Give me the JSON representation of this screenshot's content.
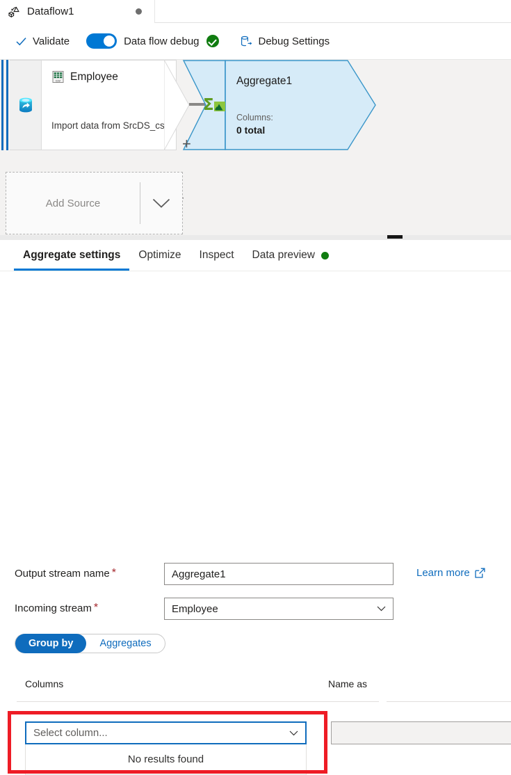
{
  "tab": {
    "icon": "dataflow-icon",
    "title": "Dataflow1",
    "dirty_dot": "unsaved-indicator"
  },
  "toolbar": {
    "validate_label": "Validate",
    "validate_icon": "checkmark-icon",
    "debug_toggle_label": "Data flow debug",
    "debug_toggle_state": "on",
    "debug_status_icon": "success-check-icon",
    "debug_settings_label": "Debug Settings",
    "debug_settings_icon": "database-export-icon"
  },
  "canvas": {
    "source_node": {
      "title": "Employee",
      "title_icon": "csv-file-icon",
      "side_icon": "azure-data-lake-icon",
      "subtitle": "Import data from SrcDS_csv",
      "add_icon": "plus-icon"
    },
    "aggregate_node": {
      "title": "Aggregate1",
      "icon": "sigma-aggregate-icon",
      "columns_label": "Columns:",
      "columns_total": "0 total",
      "add_icon": "plus-icon",
      "fill_color": "#d6ebf8",
      "border_color": "#3a96c9"
    },
    "add_source": {
      "label": "Add Source",
      "chevron_icon": "chevron-down-icon"
    }
  },
  "splitter": {
    "handle": "resize-handle"
  },
  "panel_tabs": [
    {
      "label": "Aggregate settings",
      "selected": true
    },
    {
      "label": "Optimize",
      "selected": false
    },
    {
      "label": "Inspect",
      "selected": false
    },
    {
      "label": "Data preview",
      "selected": false,
      "status_dot": "#107c10"
    }
  ],
  "settings": {
    "output_stream": {
      "label": "Output stream name",
      "required": "*",
      "value": "Aggregate1"
    },
    "incoming_stream": {
      "label": "Incoming stream",
      "required": "*",
      "value": "Employee",
      "chevron_icon": "chevron-down-icon"
    },
    "learn_more": {
      "label": "Learn more",
      "icon": "external-link-icon",
      "color": "#0f6cbd"
    },
    "pivot": [
      {
        "label": "Group by",
        "active": true
      },
      {
        "label": "Aggregates",
        "active": false
      }
    ],
    "table": {
      "headers": [
        "Columns",
        "Name as"
      ],
      "column_select": {
        "placeholder": "Select column...",
        "value": "",
        "chevron_icon": "chevron-down-icon",
        "dropdown_message": "No results found"
      },
      "name_as": {
        "value": "",
        "disabled": true
      }
    },
    "highlight": {
      "color": "#ee1c25",
      "target": "column-select-dropdown"
    }
  }
}
